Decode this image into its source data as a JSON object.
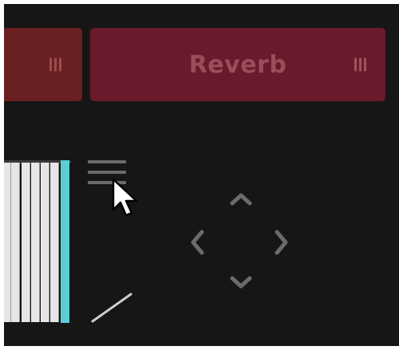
{
  "fx_slots": [
    {
      "label": "",
      "color": "#6a1f22"
    },
    {
      "label": "Reverb",
      "color": "#6b1a2c"
    }
  ],
  "icons": {
    "grip": "grip-handle-icon",
    "menu": "hamburger-menu-icon",
    "cursor": "mouse-pointer-icon",
    "dpad": "directional-arrows-icon",
    "diagonal": "diagonal-line-icon"
  },
  "colors": {
    "background": "#161616",
    "accent_key": "#5ccfd6",
    "slot_text": "#9a4e5c"
  }
}
